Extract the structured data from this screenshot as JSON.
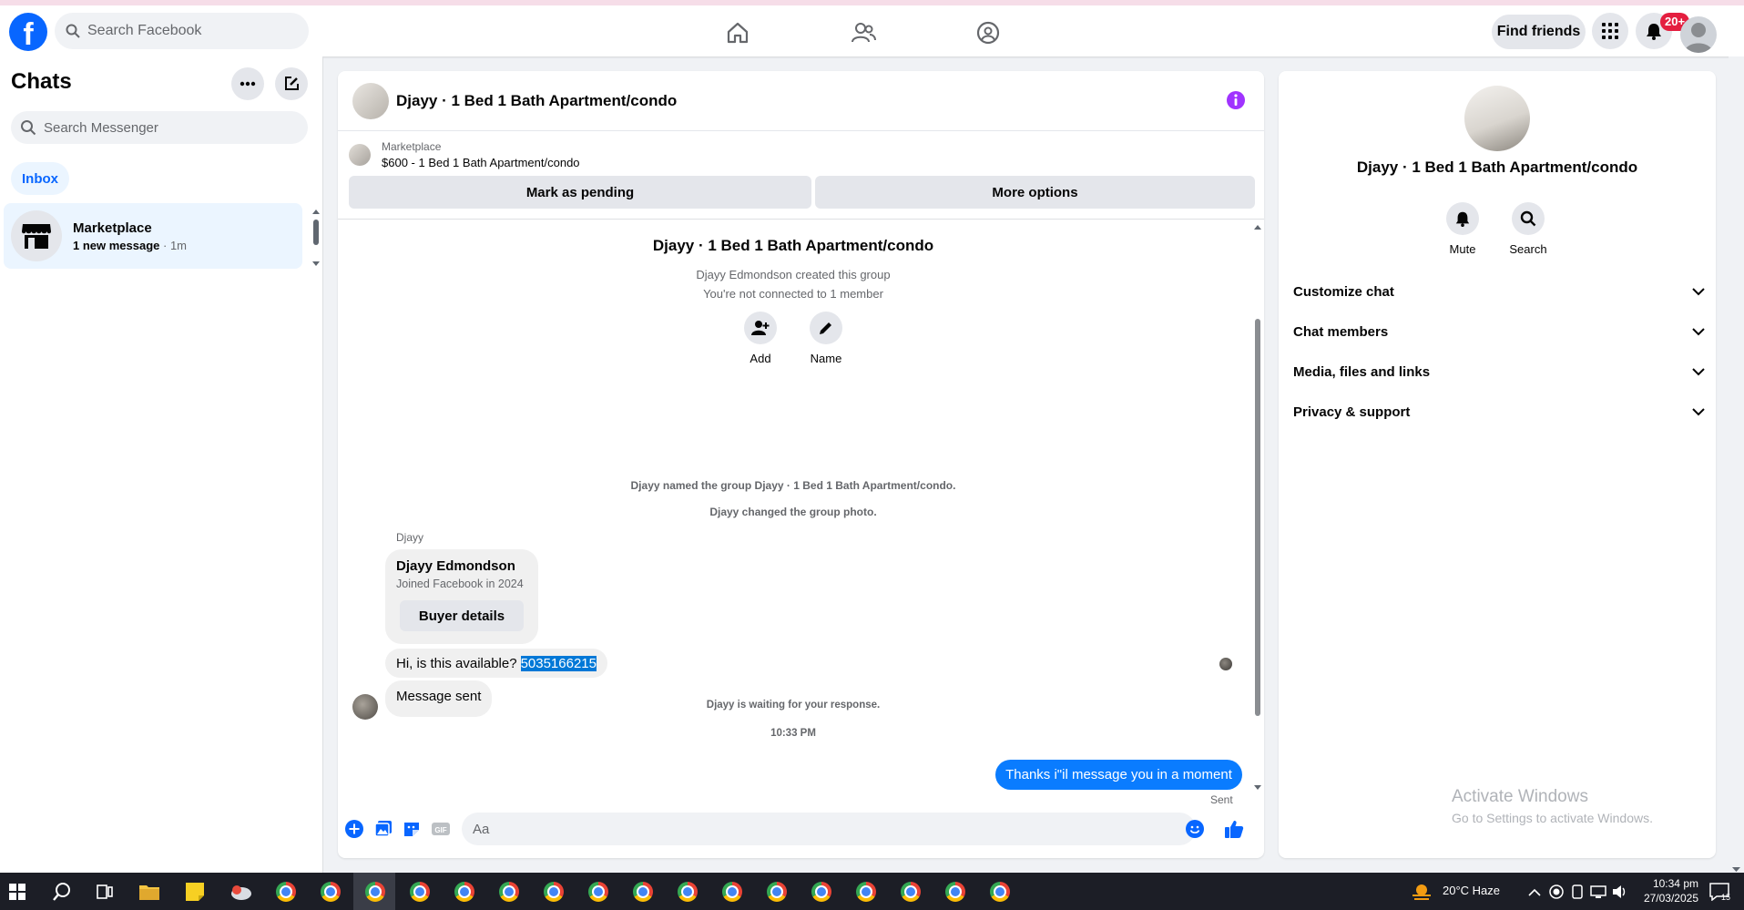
{
  "topbar": {
    "search_placeholder": "Search Facebook",
    "find_friends": "Find friends",
    "notifications_badge": "20+"
  },
  "left": {
    "title": "Chats",
    "search_placeholder": "Search Messenger",
    "inbox_label": "Inbox",
    "chats": [
      {
        "name": "Marketplace",
        "preview": "1 new message",
        "time": "· 1m"
      }
    ]
  },
  "conversation": {
    "title": "Djayy · 1 Bed 1 Bath Apartment/condo",
    "listing_source": "Marketplace",
    "listing_title": "$600 - 1 Bed 1 Bath Apartment/condo",
    "mark_pending": "Mark as pending",
    "more_options": "More options",
    "group_name": "Djayy · 1 Bed 1 Bath Apartment/condo",
    "created_by": "Djayy Edmondson created this group",
    "not_connected": "You're not connected to 1 member",
    "add_label": "Add",
    "name_label": "Name",
    "sys_named": "Djayy named the group Djayy · 1 Bed 1 Bath Apartment/condo.",
    "sys_photo": "Djayy changed the group photo.",
    "sender_name": "Djayy",
    "card_name": "Djayy Edmondson",
    "card_joined": "Joined Facebook in 2024",
    "card_button": "Buyer details",
    "msg1_text": "Hi, is this available?",
    "msg1_phone": "5035166215",
    "msg2_text": "Message sent",
    "waiting": "Djayy is waiting for your response.",
    "timestamp": "10:33 PM",
    "my_message": "Thanks i\"il message you in a moment",
    "sent_status": "Sent",
    "composer_placeholder": "Aa"
  },
  "right": {
    "title": "Djayy · 1 Bed 1 Bath Apartment/condo",
    "mute": "Mute",
    "search": "Search",
    "sections": [
      "Customize chat",
      "Chat members",
      "Media, files and links",
      "Privacy & support"
    ],
    "watermark_title": "Activate Windows",
    "watermark_sub": "Go to Settings to activate Windows."
  },
  "taskbar": {
    "weather": "20°C  Haze",
    "time": "10:34 pm",
    "date": "27/03/2025",
    "notif_count": "15"
  },
  "colors": {
    "brand": "#0866ff",
    "my_bubble": "#0a7cff",
    "badge": "#e41e3f",
    "info": "#a033ff"
  }
}
